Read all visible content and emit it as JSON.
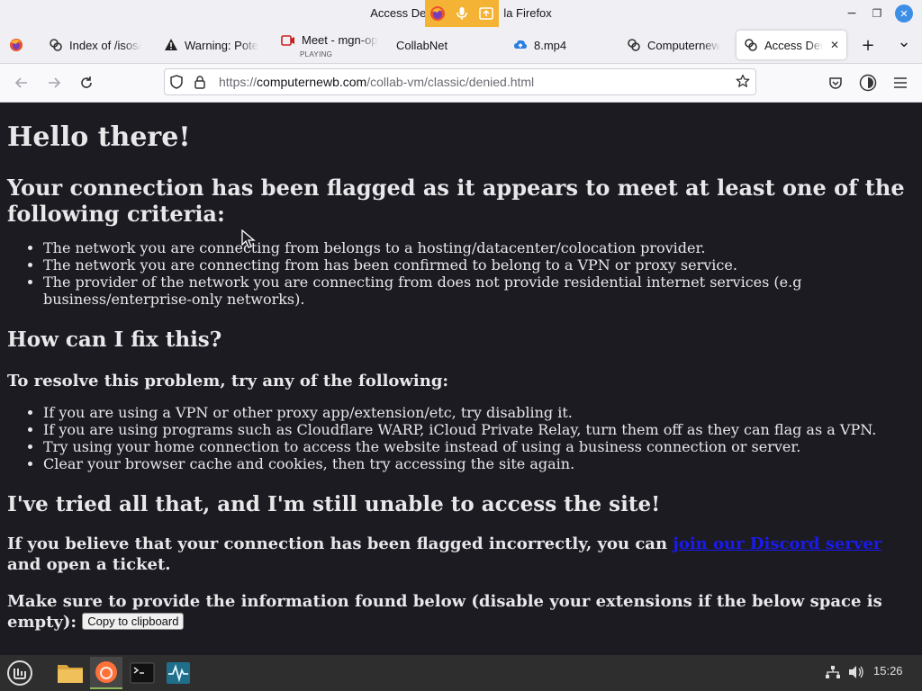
{
  "window": {
    "title_left": "Access De",
    "title_right": "la Firefox",
    "minimize": "−",
    "maximize": "❐",
    "close": "✕"
  },
  "tabs": [
    {
      "label": "",
      "icon": "firefox-view-icon"
    },
    {
      "label": "Index of /isos/",
      "icon": "site-favicon"
    },
    {
      "label": "Warning: Pote",
      "icon": "warning-icon"
    },
    {
      "label": "Meet - mgn-op",
      "sub": "PLAYING",
      "icon": "meet-icon"
    },
    {
      "label": "CollabNet",
      "icon": ""
    },
    {
      "label": "8.mp4",
      "icon": "cloud-upload-icon"
    },
    {
      "label": "Computernew",
      "icon": "site-favicon"
    },
    {
      "label": "Access Deni",
      "icon": "site-favicon",
      "active": true
    }
  ],
  "tabstrip": {
    "new_tab": "+",
    "list_all": "⌄",
    "close_tab": "✕"
  },
  "navbar": {
    "url_scheme": "https://",
    "url_host": "computernewb.com",
    "url_path": "/collab-vm/classic/denied.html"
  },
  "content": {
    "heading": "Hello there!",
    "flagged_heading": "Your connection has been flagged as it appears to meet at least one of the following criteria:",
    "criteria": [
      "The network you are connecting from belongs to a hosting/datacenter/colocation provider.",
      "The network you are connecting from has been confirmed to belong to a VPN or proxy service.",
      "The provider of the network you are connecting from does not provide residential internet services (e.g business/enterprise-only networks)."
    ],
    "fix_heading": "How can I fix this?",
    "resolve_heading": "To resolve this problem, try any of the following:",
    "fixes": [
      "If you are using a VPN or other proxy app/extension/etc, try disabling it.",
      "If you are using programs such as Cloudflare WARP, iCloud Private Relay, turn them off as they can flag as a VPN.",
      "Try using your home connection to access the website instead of using a business connection or server.",
      "Clear your browser cache and cookies, then try accessing the site again."
    ],
    "tried_heading": "I've tried all that, and I'm still unable to access the site!",
    "incorrect_pre": "If you believe that your connection has been flagged incorrectly, you can ",
    "discord_link": "join our Discord server",
    "incorrect_post": " and open a ticket.",
    "provide_info": "Make sure to provide the information found below (disable your extensions if the below space is empty): ",
    "copy_button": "Copy to clipboard"
  },
  "taskbar": {
    "clock": "15:26"
  },
  "colors": {
    "page_bg": "#1c1b22",
    "link": "#1a1aee",
    "sharing_indicator": "#f5b335",
    "close_button": "#3d8fe5"
  }
}
